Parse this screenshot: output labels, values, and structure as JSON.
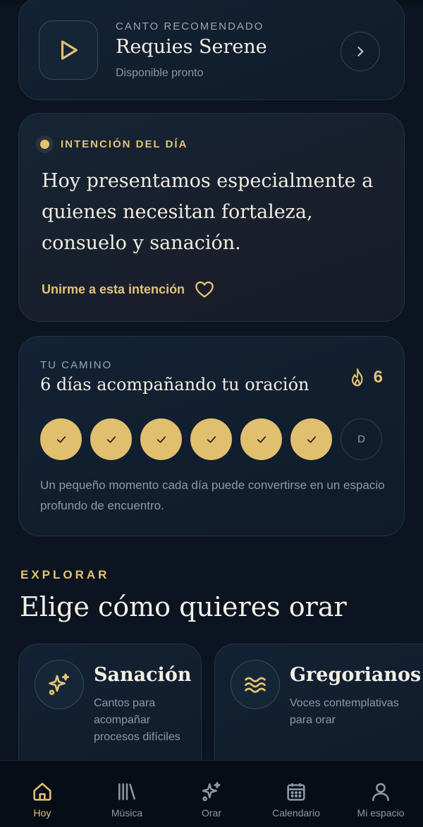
{
  "canto": {
    "overline": "CANTO RECOMENDADO",
    "title": "Requies Serene",
    "subtitle": "Disponible pronto"
  },
  "intention": {
    "label": "INTENCIÓN DEL DÍA",
    "text": "Hoy presentamos especialmente a quienes necesitan fortaleza, consuelo y sanación.",
    "join_label": "Unirme a esta intención"
  },
  "camino": {
    "overline": "TU CAMINO",
    "title": "6 días acompañando tu oración",
    "streak": "6",
    "days": [
      {
        "done": true,
        "label": ""
      },
      {
        "done": true,
        "label": ""
      },
      {
        "done": true,
        "label": ""
      },
      {
        "done": true,
        "label": ""
      },
      {
        "done": true,
        "label": ""
      },
      {
        "done": true,
        "label": ""
      },
      {
        "done": false,
        "label": "D"
      }
    ],
    "note": "Un pequeño momento cada día puede convertirse en un espacio profundo de encuentro."
  },
  "explore": {
    "overline": "EXPLORAR",
    "title": "Elige cómo quieres orar",
    "categories": [
      {
        "title": "Sanación",
        "description": "Cantos para acompañar procesos difíciles",
        "icon": "sparkles-icon"
      },
      {
        "title": "Gregorianos",
        "description": "Voces contemplativas para orar",
        "icon": "waves-icon"
      }
    ]
  },
  "nav": {
    "items": [
      {
        "label": "Hoy",
        "icon": "home-icon",
        "active": true
      },
      {
        "label": "Música",
        "icon": "library-icon",
        "active": false
      },
      {
        "label": "Orar",
        "icon": "sparkles-icon",
        "active": false
      },
      {
        "label": "Calendario",
        "icon": "calendar-icon",
        "active": false
      },
      {
        "label": "Mi espacio",
        "icon": "user-icon",
        "active": false
      }
    ]
  },
  "colors": {
    "background": "#0b1420",
    "accent": "#e3c272",
    "card": "#132234",
    "muted_text": "#8d98a4"
  }
}
